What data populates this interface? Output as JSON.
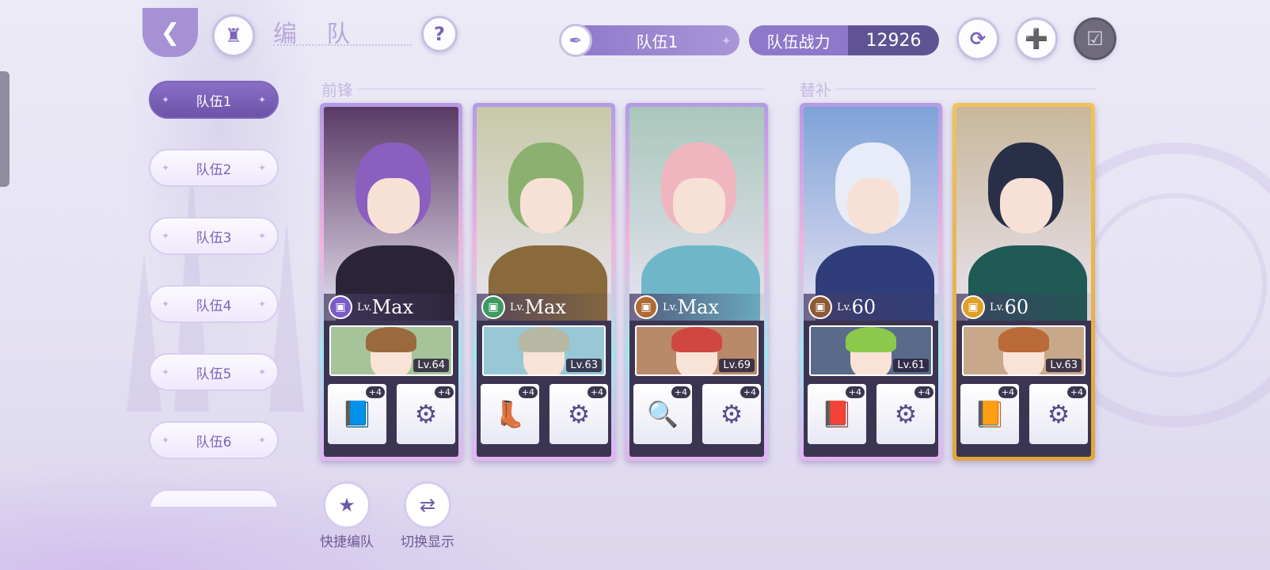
{
  "header": {
    "title": "编 队",
    "back_icon": "back-arrow-icon",
    "home_icon": "castle-icon",
    "help_label": "?"
  },
  "team_select": {
    "name": "队伍1",
    "icon": "feather-icon"
  },
  "power": {
    "label": "队伍战力",
    "value": "12926"
  },
  "toolbar": {
    "refresh_icon": "refresh-icon",
    "add_icon": "add-copy-icon",
    "confirm_icon": "checklist-icon"
  },
  "teams": [
    "队伍1",
    "队伍2",
    "队伍3",
    "队伍4",
    "队伍5",
    "队伍6"
  ],
  "sections": {
    "front": "前锋",
    "sub": "替补"
  },
  "cards": [
    {
      "attr_color": "#7a5bc7",
      "attr_icon": "book-icon",
      "lv_prefix": "Lv.",
      "lv": "Max",
      "hair": "#8a5fc0",
      "outfit": "#2b2338",
      "bg": "#5a3a66",
      "support_lv": "Lv.64",
      "support_hair": "#9a6a3e",
      "support_bg": "#a6c49a",
      "equip1": "📘",
      "equip2": "⚙",
      "plus1": "+4",
      "plus2": "+4"
    },
    {
      "attr_color": "#3d9a63",
      "attr_icon": "boot-icon",
      "lv_prefix": "Lv.",
      "lv": "Max",
      "hair": "#8bb070",
      "outfit": "#8a6a3a",
      "bg": "#c7c9a8",
      "support_lv": "Lv.63",
      "support_hair": "#b7b7a4",
      "support_bg": "#98c8d6",
      "equip1": "👢",
      "equip2": "⚙",
      "plus1": "+4",
      "plus2": "+4"
    },
    {
      "attr_color": "#b06a36",
      "attr_icon": "key-icon",
      "lv_prefix": "Lv.",
      "lv": "Max",
      "hair": "#f0b6c0",
      "outfit": "#6fb7c8",
      "bg": "#a9c7bb",
      "support_lv": "Lv.69",
      "support_hair": "#d0473f",
      "support_bg": "#b88a6a",
      "equip1": "🔍",
      "equip2": "⚙",
      "plus1": "+4",
      "plus2": "+4"
    },
    {
      "attr_color": "#8e5a34",
      "attr_icon": "book-icon",
      "lv_prefix": "Lv.",
      "lv": "60",
      "hair": "#e8ecf8",
      "outfit": "#2f3e7a",
      "bg": "#7ea2d8",
      "support_lv": "Lv.61",
      "support_hair": "#8cc84a",
      "support_bg": "#5a6a8a",
      "equip1": "📕",
      "equip2": "⚙",
      "plus1": "+4",
      "plus2": "+4"
    },
    {
      "attr_color": "#e0a02a",
      "attr_icon": "book-icon",
      "lv_prefix": "Lv.",
      "lv": "60",
      "hair": "#2a2f48",
      "outfit": "#1f5a54",
      "bg": "#c8b79a",
      "support_lv": "Lv.63",
      "support_hair": "#b96a36",
      "support_bg": "#c8a88a",
      "equip1": "📙",
      "equip2": "⚙",
      "plus1": "+4",
      "plus2": "+4"
    }
  ],
  "bottom": {
    "quick": {
      "label": "快捷编队",
      "icon": "bookmark-star-icon"
    },
    "switch": {
      "label": "切换显示",
      "icon": "swap-arrows-icon"
    }
  }
}
